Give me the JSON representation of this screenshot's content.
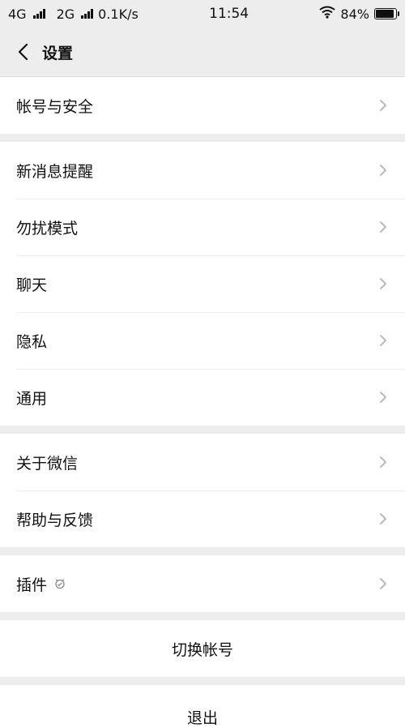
{
  "status_bar": {
    "net1": "4G",
    "net2": "2G",
    "speed": "0.1K/s",
    "time": "11:54",
    "battery": "84%",
    "battery_level": 0.84
  },
  "nav": {
    "title": "设置",
    "back_icon": "chevron-left-icon"
  },
  "groups": {
    "account": {
      "label": "帐号与安全"
    },
    "notify": [
      {
        "label": "新消息提醒"
      },
      {
        "label": "勿扰模式"
      },
      {
        "label": "聊天"
      },
      {
        "label": "隐私"
      },
      {
        "label": "通用"
      }
    ],
    "about": [
      {
        "label": "关于微信"
      },
      {
        "label": "帮助与反馈"
      }
    ],
    "plugins": {
      "label": "插件"
    }
  },
  "switch_account": "切换帐号",
  "logout": "退出",
  "colors": {
    "background": "#ededed",
    "row": "#ffffff",
    "chevron": "#b2b2b2"
  }
}
